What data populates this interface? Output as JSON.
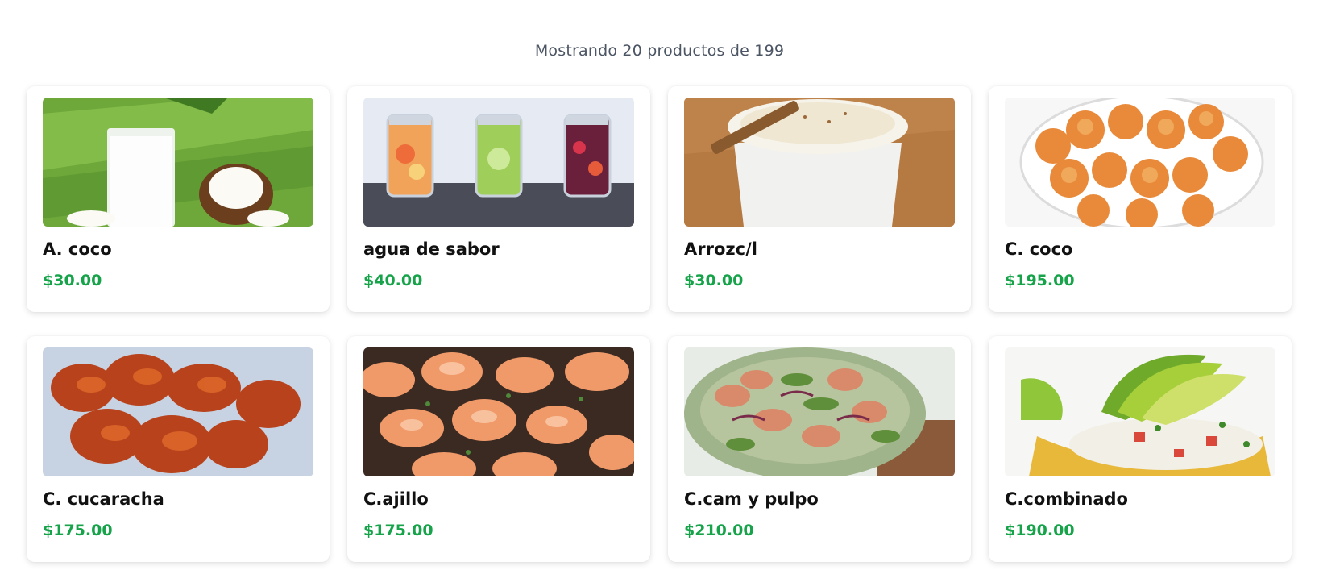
{
  "summary": "Mostrando 20 productos de 199",
  "colors": {
    "price": "#16a34a",
    "summary": "#4b5563"
  },
  "products": [
    {
      "name": "A. coco",
      "price": "$30.00",
      "image": "coconut-water-image"
    },
    {
      "name": "agua de sabor",
      "price": "$40.00",
      "image": "flavored-water-jars-image"
    },
    {
      "name": "Arrozc/l",
      "price": "$30.00",
      "image": "rice-pudding-image"
    },
    {
      "name": "C. coco",
      "price": "$195.00",
      "image": "coconut-shrimp-image"
    },
    {
      "name": "C. cucaracha",
      "price": "$175.00",
      "image": "cucaracha-shrimp-image"
    },
    {
      "name": "C.ajillo",
      "price": "$175.00",
      "image": "garlic-shrimp-image"
    },
    {
      "name": "C.cam y pulpo",
      "price": "$210.00",
      "image": "shrimp-octopus-cocktail-image"
    },
    {
      "name": "C.combinado",
      "price": "$190.00",
      "image": "combined-ceviche-tostada-image"
    }
  ]
}
